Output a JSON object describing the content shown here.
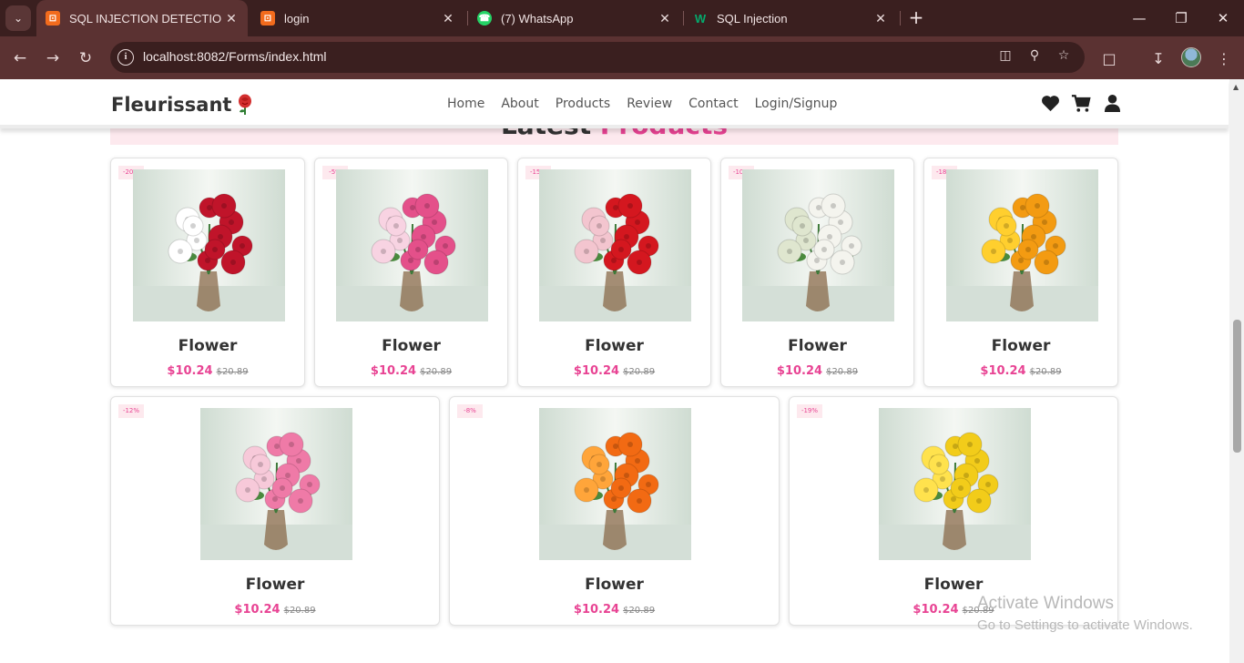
{
  "browser": {
    "tabs": [
      {
        "title": "SQL INJECTION DETECTION",
        "active": true,
        "icon": "xampp-icon",
        "icon_color": "#f26b1d"
      },
      {
        "title": "login",
        "active": false,
        "icon": "xampp-icon",
        "icon_color": "#f26b1d"
      },
      {
        "title": "(7) WhatsApp",
        "active": false,
        "icon": "whatsapp-icon",
        "icon_color": "#25d366"
      },
      {
        "title": "SQL Injection",
        "active": false,
        "icon": "w3schools-icon",
        "icon_color": "#04aa6d"
      }
    ],
    "url": "localhost:8082/Forms/index.html"
  },
  "header": {
    "logo_text": "Fleurissant",
    "nav": [
      "Home",
      "About",
      "Products",
      "Review",
      "Contact",
      "Login/Signup"
    ],
    "icons": [
      "heart-icon",
      "cart-icon",
      "user-icon"
    ]
  },
  "section": {
    "heading_left": "Latest",
    "heading_right": "Products"
  },
  "products": [
    {
      "discount": "-20%",
      "name": "Flower",
      "price": "$10.24",
      "old_price": "$20.89",
      "colors": [
        "#c0142a",
        "#ffffff"
      ]
    },
    {
      "discount": "-5%",
      "name": "Flower",
      "price": "$10.24",
      "old_price": "$20.89",
      "colors": [
        "#e4508a",
        "#f8d3e2"
      ]
    },
    {
      "discount": "-15%",
      "name": "Flower",
      "price": "$10.24",
      "old_price": "$20.89",
      "colors": [
        "#d4171f",
        "#f3c5cf"
      ]
    },
    {
      "discount": "-10%",
      "name": "Flower",
      "price": "$10.24",
      "old_price": "$20.89",
      "colors": [
        "#f4f4ee",
        "#dfe6cf"
      ]
    },
    {
      "discount": "-18%",
      "name": "Flower",
      "price": "$10.24",
      "old_price": "$20.89",
      "colors": [
        "#f39b12",
        "#ffcf2e"
      ]
    },
    {
      "discount": "-12%",
      "name": "Flower",
      "price": "$10.24",
      "old_price": "$20.89",
      "colors": [
        "#ef7aa7",
        "#f7c9d9"
      ]
    },
    {
      "discount": "-8%",
      "name": "Flower",
      "price": "$10.24",
      "old_price": "$20.89",
      "colors": [
        "#f26a13",
        "#ffa53a"
      ]
    },
    {
      "discount": "-19%",
      "name": "Flower",
      "price": "$10.24",
      "old_price": "$20.89",
      "colors": [
        "#f2cc1a",
        "#ffe24d"
      ]
    }
  ],
  "watermark": {
    "line1": "Activate Windows",
    "line2": "Go to Settings to activate Windows."
  }
}
